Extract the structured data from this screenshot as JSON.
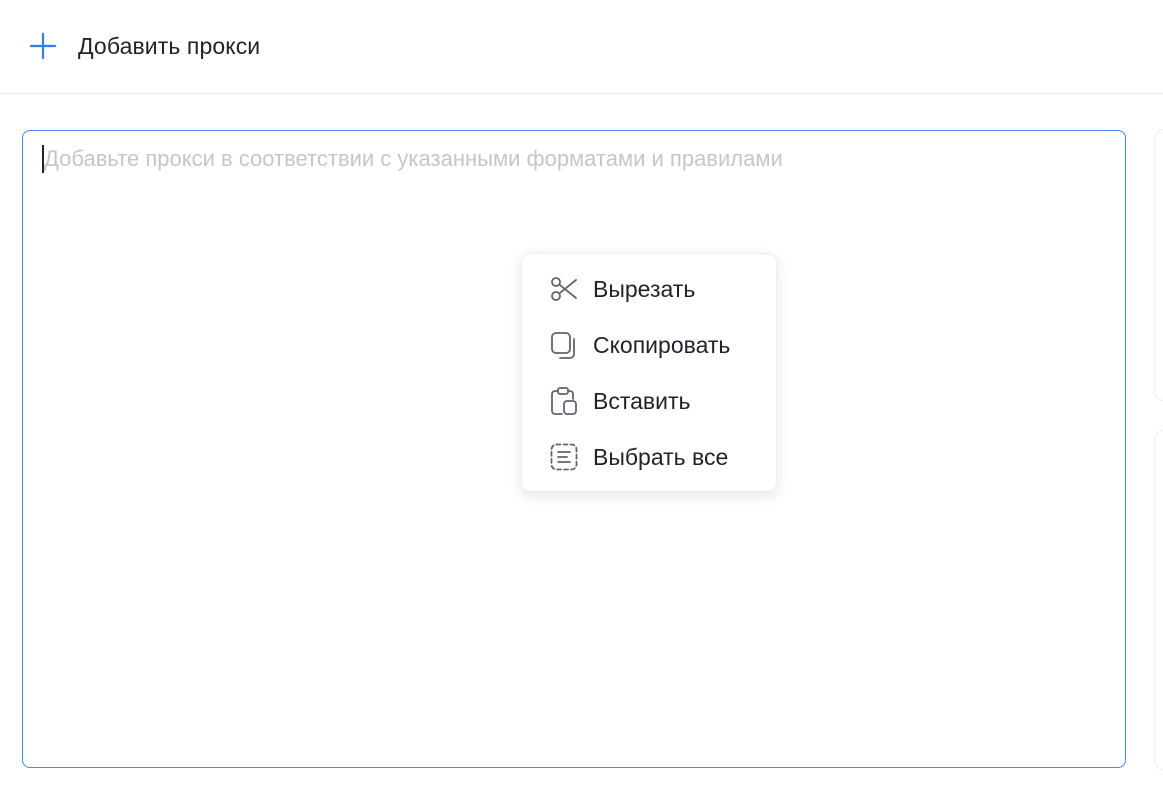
{
  "header": {
    "add_proxy_label": "Добавить прокси",
    "add_icon": "plus-icon",
    "accent_color": "#2f80ed"
  },
  "editor": {
    "placeholder": "Добавьте прокси в соответствии с указанными форматами и правилами",
    "value": "",
    "border_color": "#3b8ff6"
  },
  "context_menu": {
    "items": [
      {
        "label": "Вырезать",
        "icon": "scissors-icon"
      },
      {
        "label": "Скопировать",
        "icon": "copy-icon"
      },
      {
        "label": "Вставить",
        "icon": "paste-icon"
      },
      {
        "label": "Выбрать все",
        "icon": "select-all-icon"
      }
    ]
  }
}
